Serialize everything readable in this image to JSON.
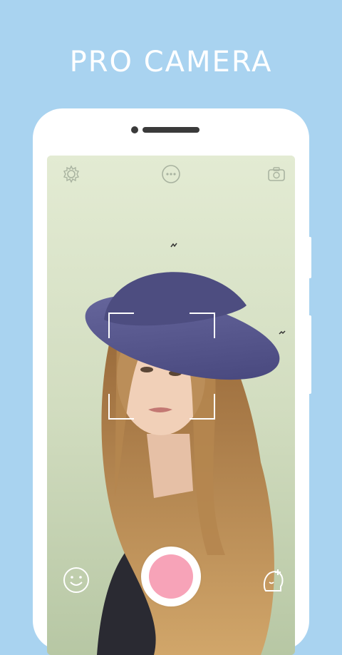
{
  "headline": "PRO CAMERA",
  "colors": {
    "background": "#a9d3f0",
    "phone": "#ffffff",
    "shutter_fill": "#f7a3b8",
    "hat": "#5a5a8a",
    "hair": "#b88a52",
    "jacket": "#2a2a32"
  },
  "icons": {
    "settings": "gear-icon",
    "more": "more-options-icon",
    "switch_camera": "switch-camera-icon",
    "face": "smiley-face-icon",
    "sticker": "sticker-icon"
  }
}
